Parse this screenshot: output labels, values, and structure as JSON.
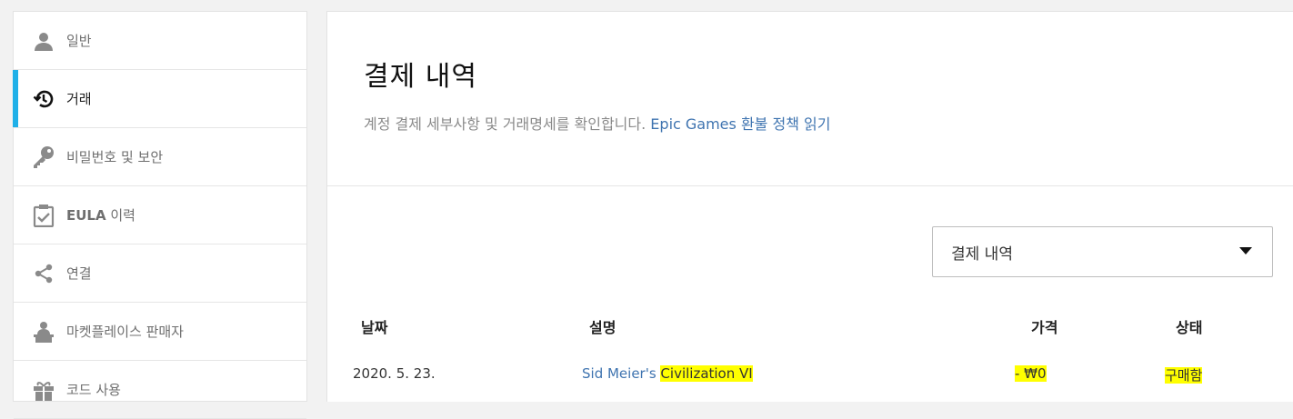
{
  "sidebar": {
    "items": [
      {
        "label": "일반",
        "icon": "person-icon"
      },
      {
        "label": "거래",
        "icon": "history-icon",
        "active": true
      },
      {
        "label": "비밀번호 및 보안",
        "icon": "key-icon"
      },
      {
        "label_bold": "EULA",
        "label": " 이력",
        "icon": "clipboard-check-icon"
      },
      {
        "label": "연결",
        "icon": "share-icon"
      },
      {
        "label": "마켓플레이스 판매자",
        "icon": "seller-icon"
      },
      {
        "label": "코드 사용",
        "icon": "gift-icon"
      }
    ]
  },
  "main": {
    "title": "결제 내역",
    "subtitle_text": "계정 결제 세부사항 및 거래명세를 확인합니다. ",
    "subtitle_link": "Epic Games 환불 정책 읽기",
    "filter": {
      "selected": "결제 내역"
    },
    "table": {
      "headers": {
        "date": "날짜",
        "description": "설명",
        "price": "가격",
        "status": "상태"
      },
      "rows": [
        {
          "date": "2020. 5. 23.",
          "desc_prefix": "Sid Meier's ",
          "desc_highlight": "Civilization VI",
          "price": "- ₩0",
          "status": "구매함"
        }
      ]
    }
  },
  "colors": {
    "accent": "#1fb0e8",
    "link": "#3f74b0",
    "highlight": "#ffff00"
  }
}
